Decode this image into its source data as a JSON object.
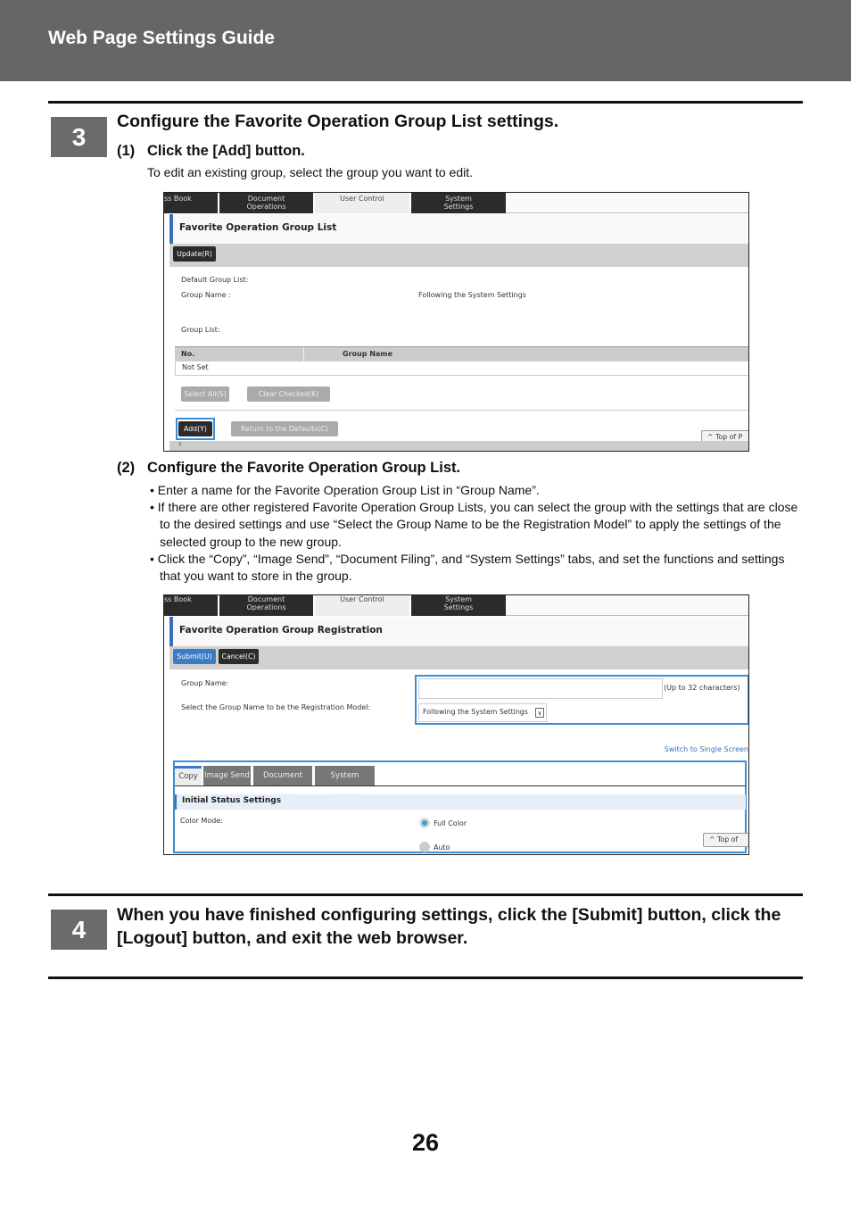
{
  "header": {
    "title": "Web Page Settings Guide"
  },
  "step3": {
    "number": "3",
    "title": "Configure the Favorite Operation Group List settings.",
    "sub1": {
      "num": "(1)",
      "title": "Click the [Add] button.",
      "text": "To edit an existing group, select the group you want to edit."
    },
    "sub2": {
      "num": "(2)",
      "title": "Configure the Favorite Operation Group List.",
      "bullets": [
        "• Enter a name for the Favorite Operation Group List in “Group Name”.",
        "• If there are other registered Favorite Operation Group Lists, you can select the group with the settings that are close to the desired settings and use “Select the Group Name to be the Registration Model” to apply the settings of the selected group to the new group.",
        "• Click the “Copy”, “Image Send”, “Document Filing”, and “System Settings” tabs, and set the functions and settings that you want to store in the group."
      ]
    }
  },
  "nav_tabs": [
    "ss Book",
    "Document\nOperations",
    "User Control",
    "System\nSettings"
  ],
  "shot1": {
    "title": "Favorite Operation Group List",
    "update": "Update(R)",
    "default_group_list": "Default Group List:",
    "group_name_label": "Group Name :",
    "group_name_value": "Following the System Settings",
    "group_list": "Group List:",
    "col_no": "No.",
    "col_name": "Group Name",
    "row": "Not Set",
    "select_all": "Select All(S)",
    "clear_checked": "Clear Checked(K)",
    "add": "Add(Y)",
    "return_defaults": "Return to the Defaults(C)",
    "top": "^ Top of P"
  },
  "shot2": {
    "title": "Favorite Operation Group Registration",
    "submit": "Submit(U)",
    "cancel": "Cancel(C)",
    "group_name_label": "Group Name:",
    "group_name_value": "",
    "group_name_hint": "(Up to 32 characters)",
    "model_label": "Select the Group Name to be the Registration Model:",
    "model_value": "Following the System Settings",
    "switch": "Switch to Single Screen",
    "tabs": [
      "Copy",
      "Image Send",
      "Document Filing",
      "System Settings"
    ],
    "section": "Initial Status Settings",
    "color_mode": "Color Mode:",
    "options": [
      "Full Color",
      "Auto"
    ],
    "selected_option": "Full Color",
    "top": "^ Top of"
  },
  "step4": {
    "number": "4",
    "title": "When you have finished configuring settings, click the [Submit] button, click the [Logout] button, and exit the web browser."
  },
  "page_number": "26",
  "colors": {
    "header": "#666666",
    "accent": "#3b8fd9"
  }
}
